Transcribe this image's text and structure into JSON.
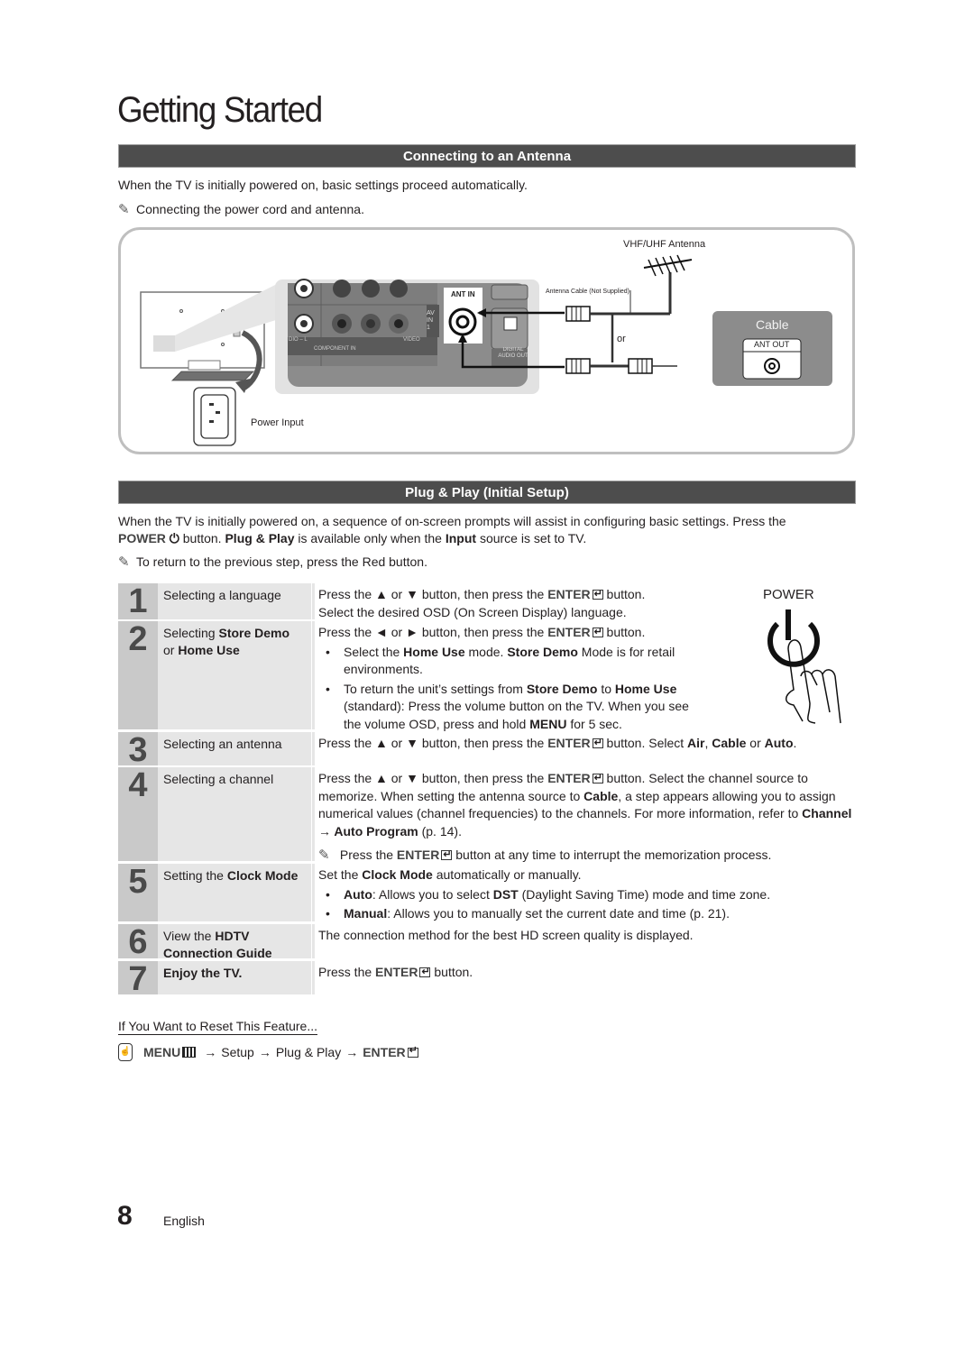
{
  "page": {
    "title": "Getting Started",
    "page_number": "8",
    "language": "English"
  },
  "antenna_section": {
    "header": "Connecting to an Antenna",
    "intro": "When the TV is initially powered on, basic settings proceed automatically.",
    "note": "Connecting the power cord and antenna.",
    "diagram": {
      "vhf_uhf_label": "VHF/UHF Antenna",
      "antenna_cable_label": "Antenna Cable (Not Supplied)",
      "or_label": "or",
      "cable_label": "Cable",
      "ant_out_label": "ANT OUT",
      "ant_in_label": "ANT IN",
      "av_in_label": "AV IN 1",
      "component_in_label": "COMPONENT IN",
      "video_label": "VIDEO",
      "audio_l_label": "DIO – L",
      "digital_audio_label": "DIGITAL AUDIO OUT",
      "power_input_label": "Power Input"
    }
  },
  "plug_play_section": {
    "header": "Plug & Play (Initial Setup)",
    "intro_line1": "When the TV is initially powered on, a sequence of on-screen prompts will assist in configuring basic settings. Press the",
    "intro_power": "POWER",
    "intro_line2_a": "button.",
    "intro_plug_play": "Plug & Play",
    "intro_line2_b": "is available only when the",
    "intro_input": "Input",
    "intro_line2_c": "source is set to TV.",
    "note": "To return to the previous step, press the Red button.",
    "power_illustration_label": "POWER",
    "enter": "ENTER",
    "steps": [
      {
        "num": "1",
        "title": "Selecting a language",
        "desc_a": "Press the ▲ or ▼ button, then press the",
        "desc_b": "button.",
        "desc_line2": "Select the desired OSD (On Screen Display) language."
      },
      {
        "num": "2",
        "title_a": "Selecting",
        "title_b": "Store Demo",
        "title_c": "or",
        "title_d": "Home Use",
        "desc_a": "Press the ◄ or ► button, then press the",
        "desc_b": "button.",
        "bullet1_a": "Select the",
        "bullet1_b": "Home Use",
        "bullet1_c": "mode.",
        "bullet1_d": "Store Demo",
        "bullet1_e": "Mode is for retail environments.",
        "bullet2_a": "To return the unit’s settings from",
        "bullet2_b": "Store Demo",
        "bullet2_c": "to",
        "bullet2_d": "Home Use",
        "bullet2_e": "(standard): Press the volume button on the TV. When you see the volume OSD, press and hold",
        "bullet2_f": "MENU",
        "bullet2_g": "for 5 sec."
      },
      {
        "num": "3",
        "title": "Selecting an antenna",
        "desc_a": "Press the ▲ or ▼ button, then press the",
        "desc_b": "button. Select",
        "opt1": "Air",
        "sep": ",",
        "opt2": "Cable",
        "or": "or",
        "opt3": "Auto",
        "end": "."
      },
      {
        "num": "4",
        "title": "Selecting a channel",
        "desc_a": "Press the ▲ or ▼ button, then press the",
        "desc_b": "button. Select the channel source to memorize. When setting the antenna source to",
        "desc_cable": "Cable",
        "desc_c": ", a step appears allowing you to assign numerical values (channel frequencies) to the channels. For more information, refer to",
        "desc_channel": "Channel → Auto Program",
        "desc_d": "(p. 14).",
        "note_a": "Press the",
        "note_b": "button at any time to interrupt the memorization process."
      },
      {
        "num": "5",
        "title_a": "Setting the",
        "title_b": "Clock Mode",
        "desc_a": "Set the",
        "desc_b": "Clock Mode",
        "desc_c": "automatically or manually.",
        "bullet1_a": "Auto",
        "bullet1_b": ": Allows you to select",
        "bullet1_c": "DST",
        "bullet1_d": "(Daylight Saving Time) mode and time zone.",
        "bullet2_a": "Manual",
        "bullet2_b": ": Allows you to manually set the current date and time (p. 21)."
      },
      {
        "num": "6",
        "title_a": "View the",
        "title_b": "HDTV Connection Guide",
        "desc": "The connection method for the best HD screen quality is displayed."
      },
      {
        "num": "7",
        "title": "Enjoy the TV.",
        "desc_a": "Press the",
        "desc_b": "button."
      }
    ]
  },
  "reset": {
    "title": "If You Want to Reset This Feature...",
    "menu": "MENU",
    "arrow": "→",
    "setup": "Setup",
    "plug_play": "Plug & Play",
    "enter": "ENTER"
  }
}
